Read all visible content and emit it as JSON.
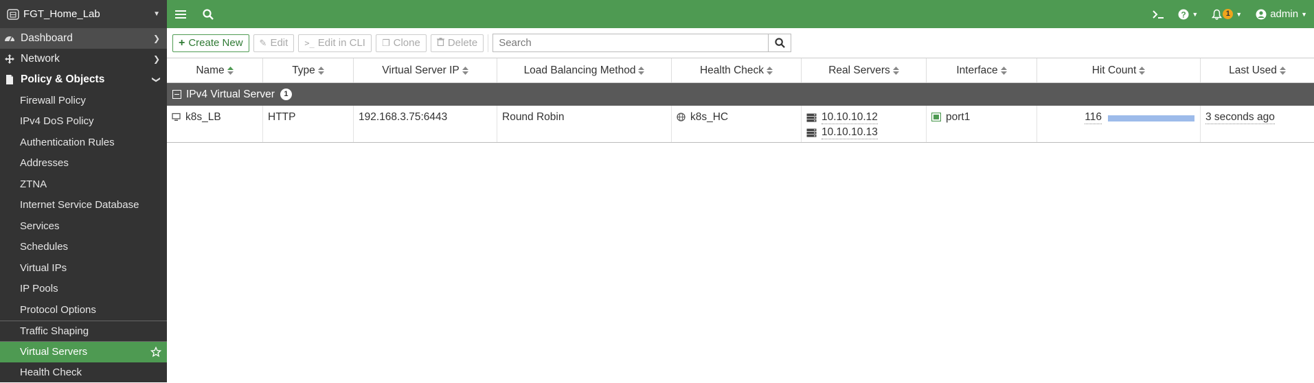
{
  "device": {
    "name": "FGT_Home_Lab"
  },
  "sidebar": {
    "top_items": [
      {
        "label": "Dashboard"
      },
      {
        "label": "Network"
      },
      {
        "label": "Policy & Objects"
      }
    ],
    "sub_items": [
      {
        "label": "Firewall Policy"
      },
      {
        "label": "IPv4 DoS Policy"
      },
      {
        "label": "Authentication Rules"
      },
      {
        "label": "Addresses"
      },
      {
        "label": "ZTNA"
      },
      {
        "label": "Internet Service Database"
      },
      {
        "label": "Services"
      },
      {
        "label": "Schedules"
      },
      {
        "label": "Virtual IPs"
      },
      {
        "label": "IP Pools"
      },
      {
        "label": "Protocol Options"
      },
      {
        "label": "Traffic Shaping"
      },
      {
        "label": "Virtual Servers"
      },
      {
        "label": "Health Check"
      }
    ],
    "active_item": "Virtual Servers"
  },
  "topbar": {
    "notification_count": "1",
    "user": "admin"
  },
  "toolbar": {
    "create_new": "Create New",
    "edit": "Edit",
    "edit_in_cli": "Edit in CLI",
    "clone": "Clone",
    "delete": "Delete",
    "search_placeholder": "Search"
  },
  "table": {
    "columns": [
      "Name",
      "Type",
      "Virtual Server IP",
      "Load Balancing Method",
      "Health Check",
      "Real Servers",
      "Interface",
      "Hit Count",
      "Last Used"
    ],
    "group": {
      "label": "IPv4 Virtual Server",
      "count": "1"
    },
    "rows": [
      {
        "name": "k8s_LB",
        "type": "HTTP",
        "vip": "192.168.3.75:6443",
        "method": "Round Robin",
        "health_check": "k8s_HC",
        "real_servers": [
          "10.10.10.12",
          "10.10.10.13"
        ],
        "interface": "port1",
        "hit_count": "116",
        "last_used": "3 seconds ago"
      }
    ]
  },
  "colors": {
    "brand_green": "#4e9a52",
    "sidebar_bg": "#333333",
    "hit_bar": "#9dbbea",
    "badge": "#f0a51c"
  }
}
